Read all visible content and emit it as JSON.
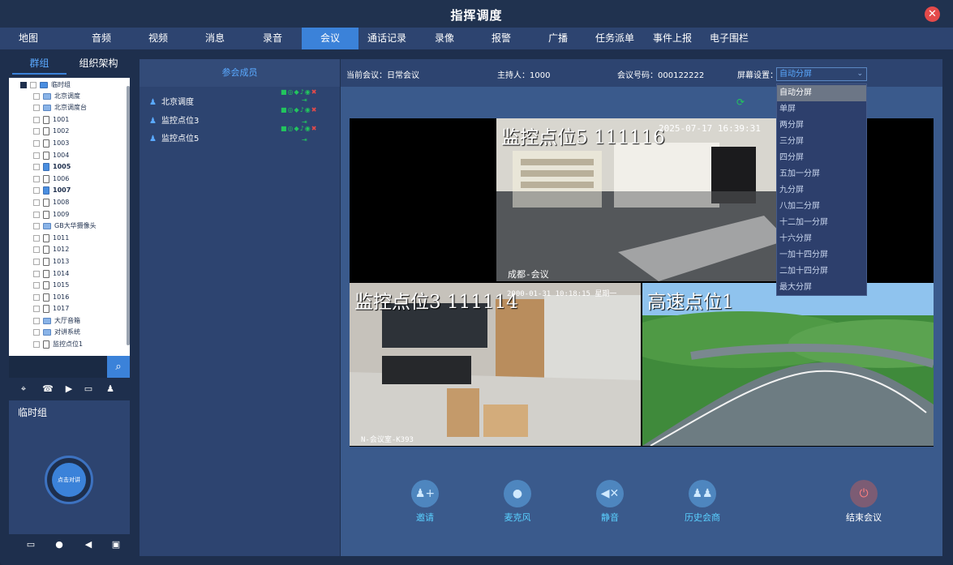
{
  "window": {
    "title": "指挥调度",
    "close_icon": "close-icon"
  },
  "nav": {
    "items": [
      "地图",
      "音频",
      "视频",
      "消息",
      "录音",
      "会议",
      "通话记录",
      "录像",
      "报警",
      "广播",
      "任务派单",
      "事件上报",
      "电子围栏"
    ],
    "active": "会议"
  },
  "left": {
    "tabs": [
      "群组",
      "组织架构"
    ],
    "active_tab": "群组",
    "tree": [
      {
        "label": "临时组",
        "type": "folder",
        "level": 0
      },
      {
        "label": "北京调度",
        "type": "pc",
        "level": 1
      },
      {
        "label": "北京调度台",
        "type": "pc",
        "level": 1
      },
      {
        "label": "1001",
        "type": "phone",
        "level": 1
      },
      {
        "label": "1002",
        "type": "phone",
        "level": 1
      },
      {
        "label": "1003",
        "type": "phone",
        "level": 1
      },
      {
        "label": "1004",
        "type": "phone",
        "level": 1
      },
      {
        "label": "1005",
        "type": "phone-active",
        "level": 1
      },
      {
        "label": "1006",
        "type": "phone",
        "level": 1
      },
      {
        "label": "1007",
        "type": "phone-active",
        "level": 1
      },
      {
        "label": "1008",
        "type": "phone",
        "level": 1
      },
      {
        "label": "1009",
        "type": "phone",
        "level": 1
      },
      {
        "label": "GB大华摄像头",
        "type": "camera",
        "level": 1
      },
      {
        "label": "1011",
        "type": "phone",
        "level": 1
      },
      {
        "label": "1012",
        "type": "phone",
        "level": 1
      },
      {
        "label": "1013",
        "type": "phone",
        "level": 1
      },
      {
        "label": "1014",
        "type": "phone",
        "level": 1
      },
      {
        "label": "1015",
        "type": "phone",
        "level": 1
      },
      {
        "label": "1016",
        "type": "phone",
        "level": 1
      },
      {
        "label": "1017",
        "type": "phone",
        "level": 1
      },
      {
        "label": "大厅音箱",
        "type": "speaker",
        "level": 1
      },
      {
        "label": "对讲系统",
        "type": "speaker",
        "level": 1
      },
      {
        "label": "监控点位1",
        "type": "camera",
        "level": 1
      }
    ],
    "search": {
      "placeholder": ""
    },
    "group_title": "临时组",
    "talk_button": "点击对讲"
  },
  "members": {
    "header": "参会成员",
    "list": [
      "北京调度",
      "监控点位3",
      "监控点位5"
    ]
  },
  "meeting": {
    "current_label": "当前会议：",
    "current_value": "日常会议",
    "host_label": "主持人：",
    "host_value": "1000",
    "id_label": "会议号码：",
    "id_value": "000122222",
    "screen_label": "屏幕设置：",
    "screen_value": "自动分屏"
  },
  "screen_options": [
    "自动分屏",
    "单屏",
    "两分屏",
    "三分屏",
    "四分屏",
    "五加一分屏",
    "九分屏",
    "八加二分屏",
    "十二加一分屏",
    "十六分屏",
    "一加十四分屏",
    "二加十四分屏",
    "最大分屏"
  ],
  "tiles": [
    {
      "title": "监控点位5 111116",
      "timestamp": "2025-07-17 16:39:31",
      "caption": "成都-会议"
    },
    {
      "title": "监控点位3 111114",
      "timestamp": "2000-01-31 10:18:15 星期一",
      "caption": "N-会议室-K393"
    },
    {
      "title": "高速点位1",
      "timestamp": "",
      "caption": ""
    }
  ],
  "actions": [
    "邀请",
    "麦克风",
    "静音",
    "历史会商",
    "结束会议"
  ],
  "colors": {
    "accent": "#3b82d9",
    "active_nav": "#3b82d9",
    "green": "#22c55e",
    "red": "#e44a4a",
    "panel": "#2d4470"
  }
}
